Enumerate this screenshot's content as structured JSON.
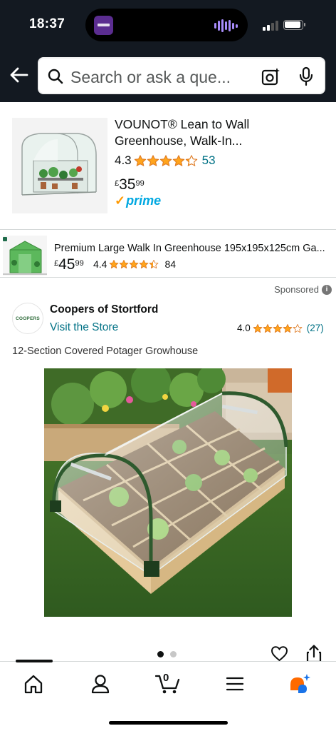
{
  "status_bar": {
    "time": "18:37"
  },
  "search": {
    "placeholder": "Search or ask a que..."
  },
  "product_1": {
    "title": "VOUNOT® Lean to Wall Greenhouse, Walk-In...",
    "rating": "4.3",
    "rating_value": 4.3,
    "review_count": "53",
    "price_currency": "£",
    "price_whole": "35",
    "price_fraction": "99",
    "prime_label": "prime"
  },
  "product_2": {
    "title": "Premium Large Walk In Greenhouse 195x195x125cm Ga...",
    "price_currency": "£",
    "price_whole": "45",
    "price_fraction": "99",
    "rating": "4.4",
    "rating_value": 4.4,
    "review_count": "84"
  },
  "sponsored_ad": {
    "sponsored_label": "Sponsored",
    "brand_logo_text": "COOPERS",
    "brand_name": "Coopers of Stortford",
    "store_link": "Visit the Store",
    "rating": "4.0",
    "rating_value": 4.0,
    "review_count": "(27)",
    "product_title": "12-Section Covered Potager Growhouse",
    "carousel_pages": 2,
    "carousel_active": 1
  },
  "bottom_nav": {
    "items": [
      "home-icon",
      "account-icon",
      "cart-icon",
      "menu-icon",
      "rufus-icon"
    ],
    "cart_count": "0"
  },
  "colors": {
    "header_bg": "#131921",
    "link": "#007185",
    "star": "#ffa41c",
    "prime_blue": "#00a8e1",
    "prime_check": "#ff9900",
    "rufus_orange": "#ff6a00",
    "rufus_blue": "#1a73e8"
  }
}
